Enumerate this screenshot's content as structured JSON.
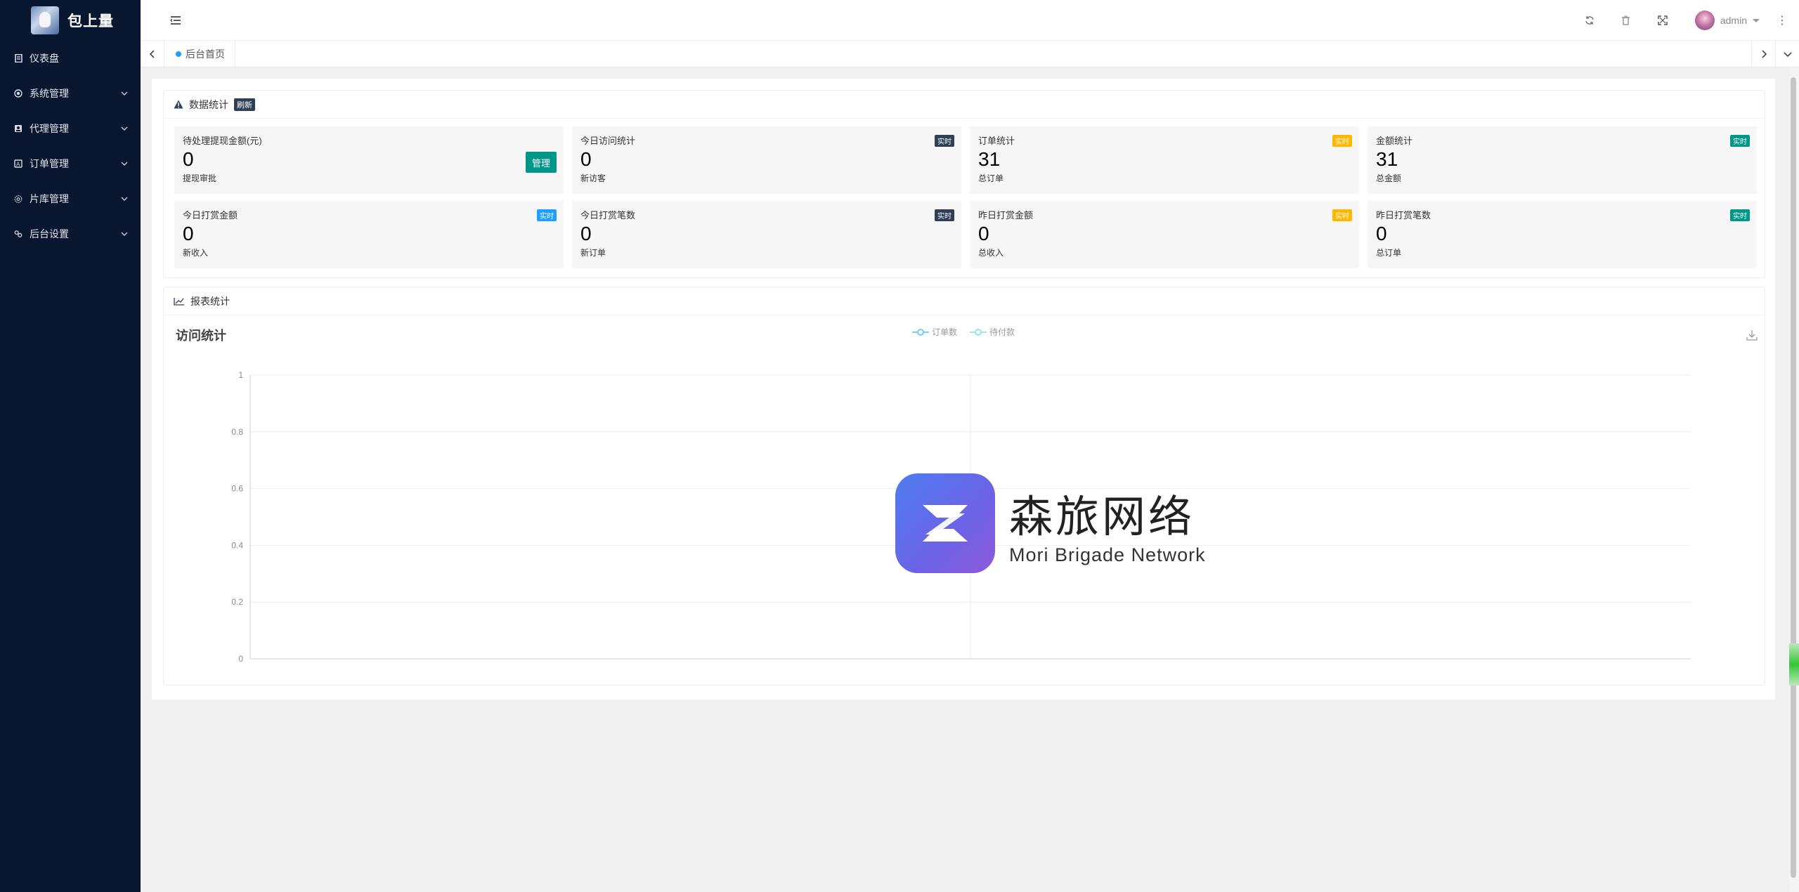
{
  "app": {
    "title": "包上量"
  },
  "sidebar": {
    "items": [
      {
        "label": "仪表盘",
        "icon": "dashboard-icon",
        "has_children": false
      },
      {
        "label": "系统管理",
        "icon": "settings-icon",
        "has_children": true
      },
      {
        "label": "代理管理",
        "icon": "agent-icon",
        "has_children": true
      },
      {
        "label": "订单管理",
        "icon": "order-icon",
        "has_children": true
      },
      {
        "label": "片库管理",
        "icon": "library-icon",
        "has_children": true
      },
      {
        "label": "后台设置",
        "icon": "admin-settings-icon",
        "has_children": true
      }
    ]
  },
  "header": {
    "user": "admin"
  },
  "tabs": [
    {
      "label": "后台首页",
      "active": true
    }
  ],
  "stats_card": {
    "title": "数据统计",
    "refresh_badge": "刷新",
    "items": [
      {
        "title": "待处理提现金额(元)",
        "value": "0",
        "sub": "提现审批",
        "button": "管理"
      },
      {
        "title": "今日访问统计",
        "value": "0",
        "sub": "新访客",
        "badge": "实时",
        "badge_color": "#2f4056"
      },
      {
        "title": "订单统计",
        "value": "31",
        "sub": "总订单",
        "badge": "实时",
        "badge_color": "#ffb800"
      },
      {
        "title": "金额统计",
        "value": "31",
        "sub": "总金额",
        "badge": "实时",
        "badge_color": "#009688"
      },
      {
        "title": "今日打赏金额",
        "value": "0",
        "sub": "新收入",
        "badge": "实时",
        "badge_color": "#1e9fff"
      },
      {
        "title": "今日打赏笔数",
        "value": "0",
        "sub": "新订单",
        "badge": "实时",
        "badge_color": "#2f4056"
      },
      {
        "title": "昨日打赏金额",
        "value": "0",
        "sub": "总收入",
        "badge": "实时",
        "badge_color": "#ffb800"
      },
      {
        "title": "昨日打赏笔数",
        "value": "0",
        "sub": "总订单",
        "badge": "实时",
        "badge_color": "#009688"
      }
    ]
  },
  "report_card": {
    "title": "报表统计"
  },
  "chart_data": {
    "type": "line",
    "title": "访问统计",
    "series": [
      {
        "name": "订单数",
        "color": "#4fc3f7",
        "values": []
      },
      {
        "name": "待付款",
        "color": "#80deea",
        "values": []
      }
    ],
    "ylim": [
      0,
      1
    ],
    "yticks": [
      "0",
      "0.2",
      "0.4",
      "0.6",
      "0.8",
      "1"
    ],
    "grid": true,
    "legend": "top-center"
  },
  "watermark": {
    "cn": "森旅网络",
    "en": "Mori Brigade Network"
  }
}
